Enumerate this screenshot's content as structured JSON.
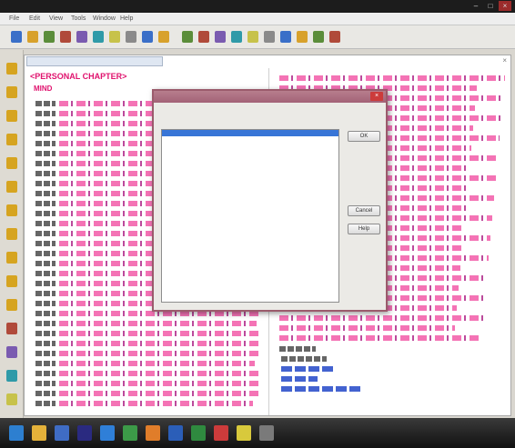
{
  "app": {
    "title": ""
  },
  "menubar": {
    "items": [
      "File",
      "Edit",
      "View",
      "Tools",
      "Window",
      "Help"
    ]
  },
  "document": {
    "tab_label": "",
    "heading": "<PERSONAL CHAPTER>",
    "subheading": "MIND"
  },
  "dialog": {
    "title": "",
    "caption": "",
    "items": [
      {
        "label": "",
        "selected": true
      },
      {
        "label": "",
        "selected": false
      },
      {
        "label": "",
        "selected": false
      },
      {
        "label": "",
        "selected": false
      },
      {
        "label": "",
        "selected": false
      },
      {
        "label": "",
        "selected": false
      },
      {
        "label": "",
        "selected": false
      },
      {
        "label": "",
        "selected": false
      },
      {
        "label": "",
        "selected": false
      },
      {
        "label": "",
        "selected": false
      },
      {
        "label": "",
        "selected": false
      }
    ],
    "buttons": {
      "ok": "OK",
      "cancel": "Cancel",
      "help": "Help"
    }
  },
  "taskbar": {
    "clock": ""
  },
  "colors": {
    "tag_pink": "#e0136e",
    "selection_blue": "#3875d7",
    "dialog_frame": "#9b5b6c",
    "close_red": "#cc3b3b"
  },
  "icons": {
    "toolbar": [
      "new-icon",
      "open-icon",
      "save-icon",
      "print-icon",
      "find-icon",
      "cut-icon",
      "copy-icon",
      "paste-icon",
      "undo-icon",
      "redo-icon",
      "bold-icon",
      "italic-icon",
      "insert-icon",
      "tag-icon",
      "link-icon",
      "image-icon",
      "table-icon",
      "spell-icon",
      "zoom-icon",
      "help-icon"
    ],
    "left": [
      "element-icon",
      "attribute-icon",
      "entity-icon",
      "comment-icon",
      "pi-icon",
      "cdata-icon",
      "text-icon",
      "list-icon",
      "note-icon",
      "ref-icon",
      "check-icon",
      "validate-icon",
      "structure-icon",
      "settings-icon",
      "info-icon"
    ],
    "taskbar": [
      "start-icon",
      "explorer-icon",
      "media-icon",
      "browser-icon",
      "mail-icon",
      "chrome-icon",
      "firefox-icon",
      "word-icon",
      "excel-icon",
      "paint-icon",
      "editor-icon",
      "folder-icon"
    ]
  }
}
